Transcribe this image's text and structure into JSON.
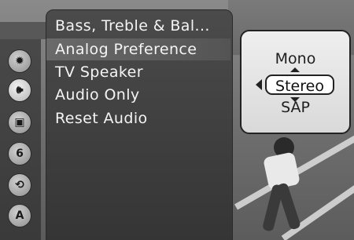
{
  "menu": {
    "items": [
      {
        "label": "Bass, Treble & Bal..."
      },
      {
        "label": "Analog Preference"
      },
      {
        "label": "TV Speaker"
      },
      {
        "label": "Audio Only"
      },
      {
        "label": "Reset Audio"
      }
    ],
    "selected_index": 1
  },
  "rail": {
    "icons": [
      "sun-icon",
      "speaker-icon",
      "tv-icon",
      "lock-icon",
      "swap-icon",
      "av-icon"
    ],
    "active_index": 1
  },
  "options": {
    "above": "Mono",
    "selected": "Stereo",
    "below": "SAP"
  }
}
